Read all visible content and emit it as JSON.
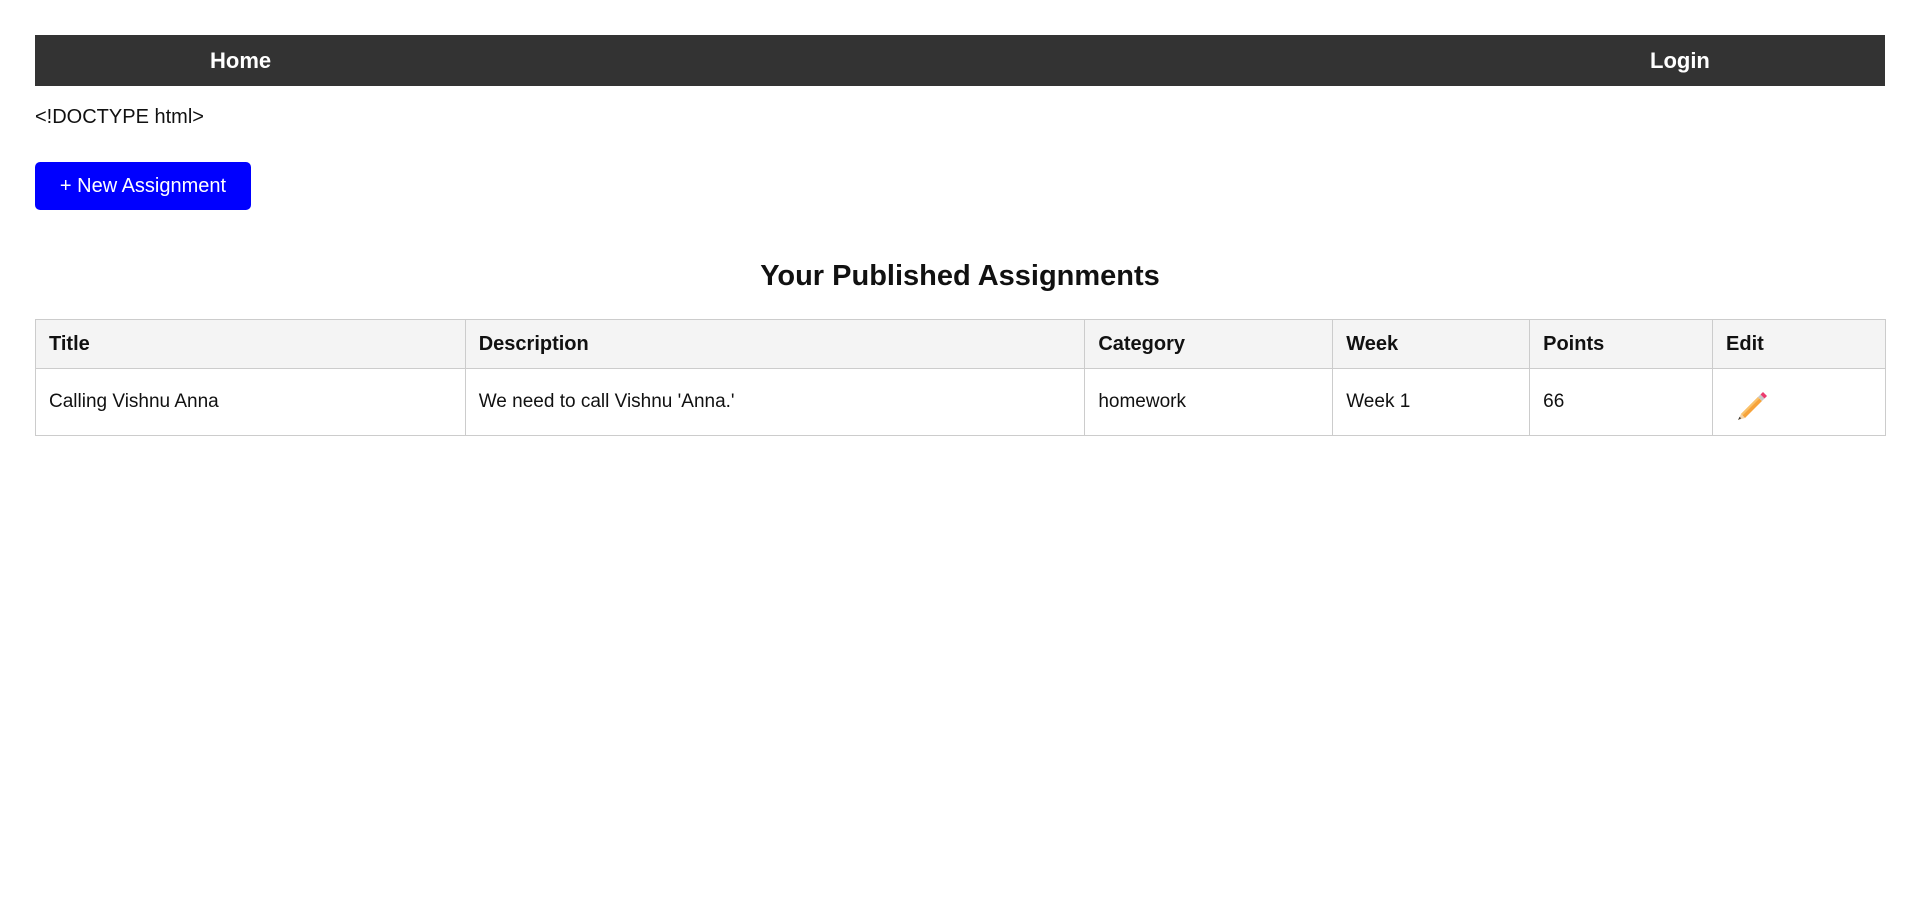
{
  "nav": {
    "home_label": "Home",
    "login_label": "Login"
  },
  "doctype_text": "<!DOCTYPE html>",
  "new_button_label": "+ New Assignment",
  "section_title": "Your Published Assignments",
  "table": {
    "headers": [
      "Title",
      "Description",
      "Category",
      "Week",
      "Points",
      "Edit"
    ],
    "rows": [
      {
        "title": "Calling Vishnu Anna",
        "description": "We need to call Vishnu 'Anna.'",
        "category": "homework",
        "week": "Week 1",
        "points": "66",
        "edit_icon": "pencil-icon"
      }
    ]
  },
  "colors": {
    "navbar_bg": "#333333",
    "button_bg": "#0000ff",
    "header_bg": "#f4f4f4",
    "border": "#cccccc"
  }
}
